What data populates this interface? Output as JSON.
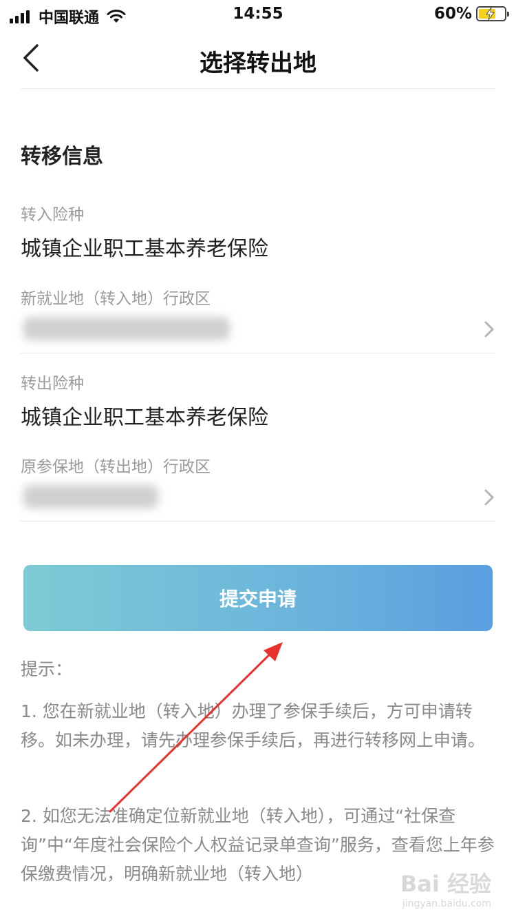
{
  "status_bar": {
    "carrier": "中国联通",
    "time": "14:55",
    "battery": "60%"
  },
  "nav": {
    "title": "选择转出地"
  },
  "section": {
    "title": "转移信息"
  },
  "fields": [
    {
      "label": "转入险种",
      "value": "城镇企业职工基本养老保险"
    },
    {
      "label": "新就业地（转入地）行政区",
      "value": ""
    },
    {
      "label": "转出险种",
      "value": "城镇企业职工基本养老保险"
    },
    {
      "label": "原参保地（转出地）行政区",
      "value": ""
    }
  ],
  "submit": {
    "label": "提交申请"
  },
  "tips": {
    "title": "提示：",
    "items": [
      "1. 您在新就业地（转入地）办理了参保手续后，方可申请转移。如未办理，请先办理参保手续后，再进行转移网上申请。",
      "2. 如您无法准确定位新就业地（转入地），可通过“社保查询”中“年度社会保险个人权益记录单查询”服务，查看您上年参保缴费情况，明确新就业地（转入地）"
    ]
  },
  "watermark": {
    "main": "Bai 经验",
    "sub": "jingyan.baidu.com"
  },
  "colors": {
    "button_start": "#7ccbd4",
    "button_end": "#5a9fe0",
    "annotation": "#e8322c",
    "label": "#9a9a9a"
  }
}
